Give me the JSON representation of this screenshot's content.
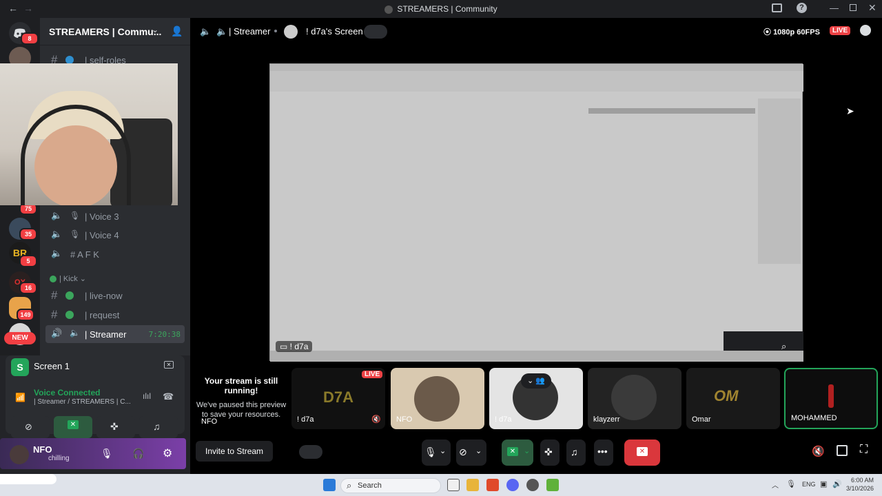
{
  "window": {
    "title": "STREAMERS | Community"
  },
  "rail": {
    "badges": [
      "8",
      "75",
      "35",
      "5",
      "16",
      "149"
    ],
    "new_label": "NEW"
  },
  "server": {
    "name": "STREAMERS | Commu..."
  },
  "channels": {
    "self_roles": "| self-roles",
    "voice3": "| Voice 3",
    "voice4": "| Voice 4",
    "afk": "# A F K",
    "category_kick": "| Kick",
    "live_now": "| live-now",
    "request": "| request",
    "streamer": "| Streamer",
    "streamer_time": "7:20:38"
  },
  "screen_panel": {
    "title": "Screen 1"
  },
  "voice": {
    "status": "Voice Connected",
    "location": "| Streamer / STREAMERS | C..."
  },
  "user": {
    "name": "NFO",
    "status": "chilling"
  },
  "stage": {
    "channel": "| Streamer",
    "screen_title": "! d7a's Screen",
    "quality": "1080p 60FPS",
    "live": "LIVE",
    "screen_owner": "! d7a"
  },
  "tiles": {
    "self_live": "LIVE",
    "self_message_title": "Your stream is still running!",
    "self_message_body": "We've paused this preview to save your resources.",
    "self_name": "! d7a",
    "self_sub": "NFO",
    "nfo": "NFO",
    "d7a": "! d7a",
    "klayzerr": "klayzerr",
    "omar": "Omar",
    "mohammed": "MOHAMMED"
  },
  "bottom": {
    "invite": "Invite to Stream"
  },
  "taskbar": {
    "search": "Search",
    "lang": "ENG",
    "time": "6:00 AM",
    "date": "3/10/2026"
  },
  "colors": {
    "accent_green": "#23a55a",
    "live_red": "#ed4245",
    "end_red": "#da373c",
    "brand": "#5865f2"
  }
}
